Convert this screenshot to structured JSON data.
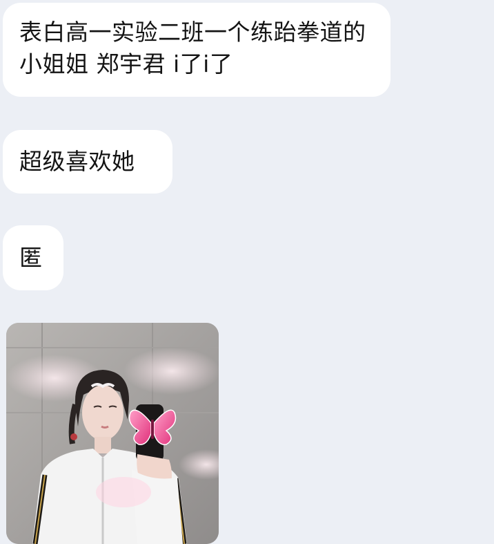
{
  "messages": [
    {
      "type": "text",
      "text": "表白高一实验二班一个练跆拳道的小姐姐 郑宇君 i了i了"
    },
    {
      "type": "text",
      "text": "超级喜欢她"
    },
    {
      "type": "text",
      "text": "匿"
    },
    {
      "type": "image",
      "subject": "mirror-selfie-photo"
    }
  ],
  "colors": {
    "background": "#eceff5",
    "bubble": "#ffffff",
    "text": "#141414"
  }
}
